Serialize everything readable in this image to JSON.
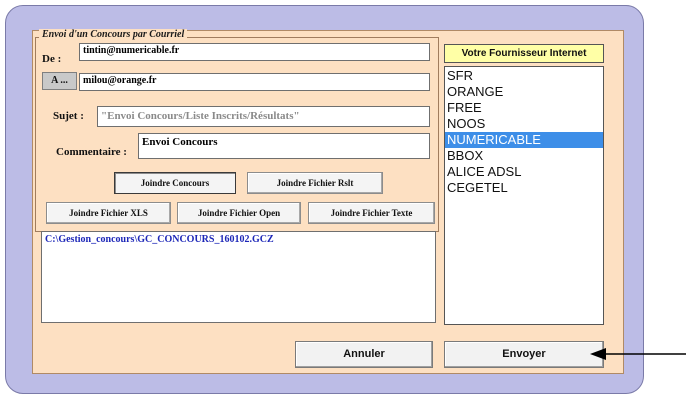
{
  "window": {
    "group_title": "Envoi d'un Concours par Courriel"
  },
  "form": {
    "from_label": "De :",
    "from_value": "tintin@numericable.fr",
    "to_button": "A ...",
    "to_value": "milou@orange.fr",
    "subject_label": "Sujet :",
    "subject_value": "\"Envoi Concours/Liste Inscrits/Résultats\"",
    "comment_label": "Commentaire :",
    "comment_value": "Envoi Concours"
  },
  "attach_buttons": {
    "concours": "Joindre Concours",
    "rslt": "Joindre Fichier Rslt",
    "xls": "Joindre Fichier XLS",
    "open": "Joindre Fichier Open",
    "texte": "Joindre Fichier Texte"
  },
  "attachments": [
    "C:\\Gestion_concours\\GC_CONCOURS_160102.GCZ"
  ],
  "isp": {
    "header": "Votre Fournisseur Internet",
    "items": [
      "SFR",
      "ORANGE",
      "FREE",
      "NOOS",
      "NUMERICABLE",
      "BBOX",
      "ALICE ADSL",
      "CEGETEL"
    ],
    "selected": "NUMERICABLE"
  },
  "actions": {
    "cancel": "Annuler",
    "send": "Envoyer"
  },
  "colors": {
    "frame": "#bcbce6",
    "panel": "#fde0c2",
    "isp_header_bg": "#ffffa6",
    "selection": "#3d8ee8",
    "attachment_text": "#1d27b8"
  },
  "icons": {
    "annotation": "arrow-left-icon"
  }
}
